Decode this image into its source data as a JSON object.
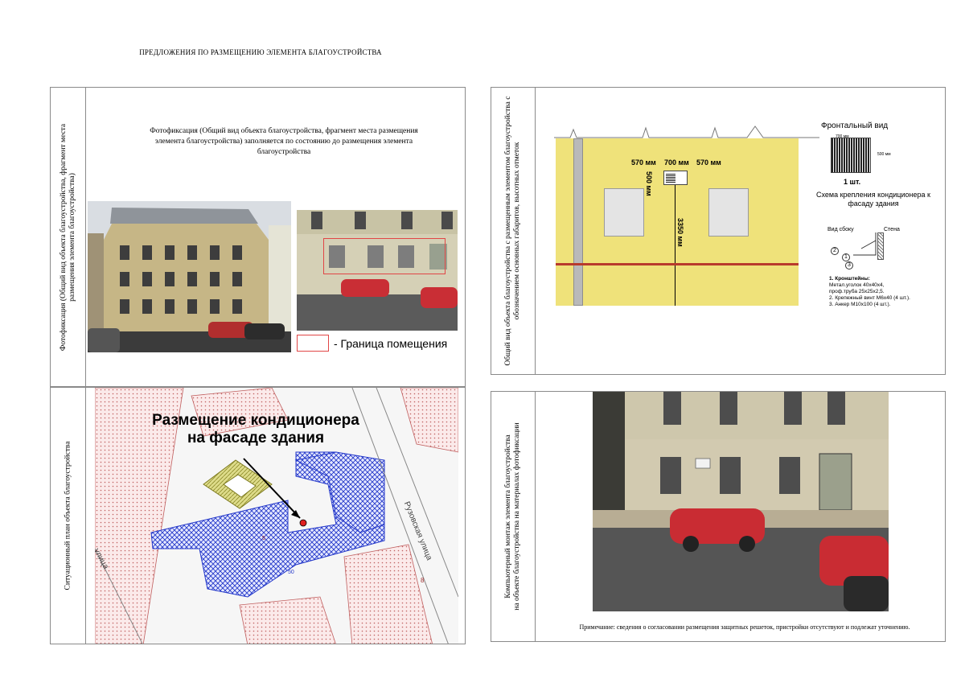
{
  "doc_title": "ПРЕДЛОЖЕНИЯ ПО РАЗМЕЩЕНИЮ ЭЛЕМЕНТА БЛАГОУСТРОЙСТВА",
  "panel_photo": {
    "side_label": "Фотофиксация (Общий вид объекта благоустройства, фрагмент места размещения элемента благоустройства)",
    "description": "Фотофиксация (Общий вид объекта благоустройства, фрагмент места размещения элемента благоустройства) заполняется по состоянию до размещения элемента благоустройства",
    "legend_text": "- Граница помещения",
    "colors": {
      "boundary": "#e14646"
    }
  },
  "panel_facade": {
    "side_label": "Общий вид объекта благоустройства с размещенным элементом благоустройства с обозначением основных габаритов, высотных отметок",
    "dims": {
      "left": "570 мм",
      "middle": "700 мм",
      "right": "570 мм",
      "vertical_small": "500 мм",
      "vertical_height": "3350 мм"
    },
    "front_title": "Фронтальный вид",
    "front_width": "700 мм",
    "front_height": "500 мм",
    "front_qty": "1 шт.",
    "schema_title": "Схема крепления кондиционера к фасаду здания",
    "side_view_label": "Вид сбоку",
    "wall_label": "Стена",
    "callouts": [
      "2",
      "1",
      "3"
    ],
    "notes": [
      "1. Кронштейны:",
      "Метал.уголок 40х40х4,",
      "проф.труба 25х25х2,5.",
      "2. Крепежный винт М6х40 (4 шт.).",
      "3. Анкер М10х100 (4 шт.)."
    ],
    "colors": {
      "facade": "#efe27a",
      "stripe": "#b83a2c"
    }
  },
  "panel_plan": {
    "side_label": "Ситуационный план объекта благоустройства",
    "map_title_line1": "Размещение кондиционера",
    "map_title_line2": "на фасаде здания",
    "street_label_1": "Рузовская улица",
    "street_label_2": "улица",
    "house_number_1": "8",
    "house_number_2": "5",
    "house_number_3": "50",
    "colors": {
      "building_hatch": "#2438c9",
      "neighbor_hatch": "#d08a8a",
      "yard": "#c5c35a"
    }
  },
  "panel_montage": {
    "side_label_line1": "Компьютерный монтаж элемента благоустройства",
    "side_label_line2": "на объекте благоустройства на материалах фотофиксации",
    "note": "Примечание: сведения о согласовании размещения защитных решеток, пристройки отсутствуют и подлежат уточнению."
  }
}
